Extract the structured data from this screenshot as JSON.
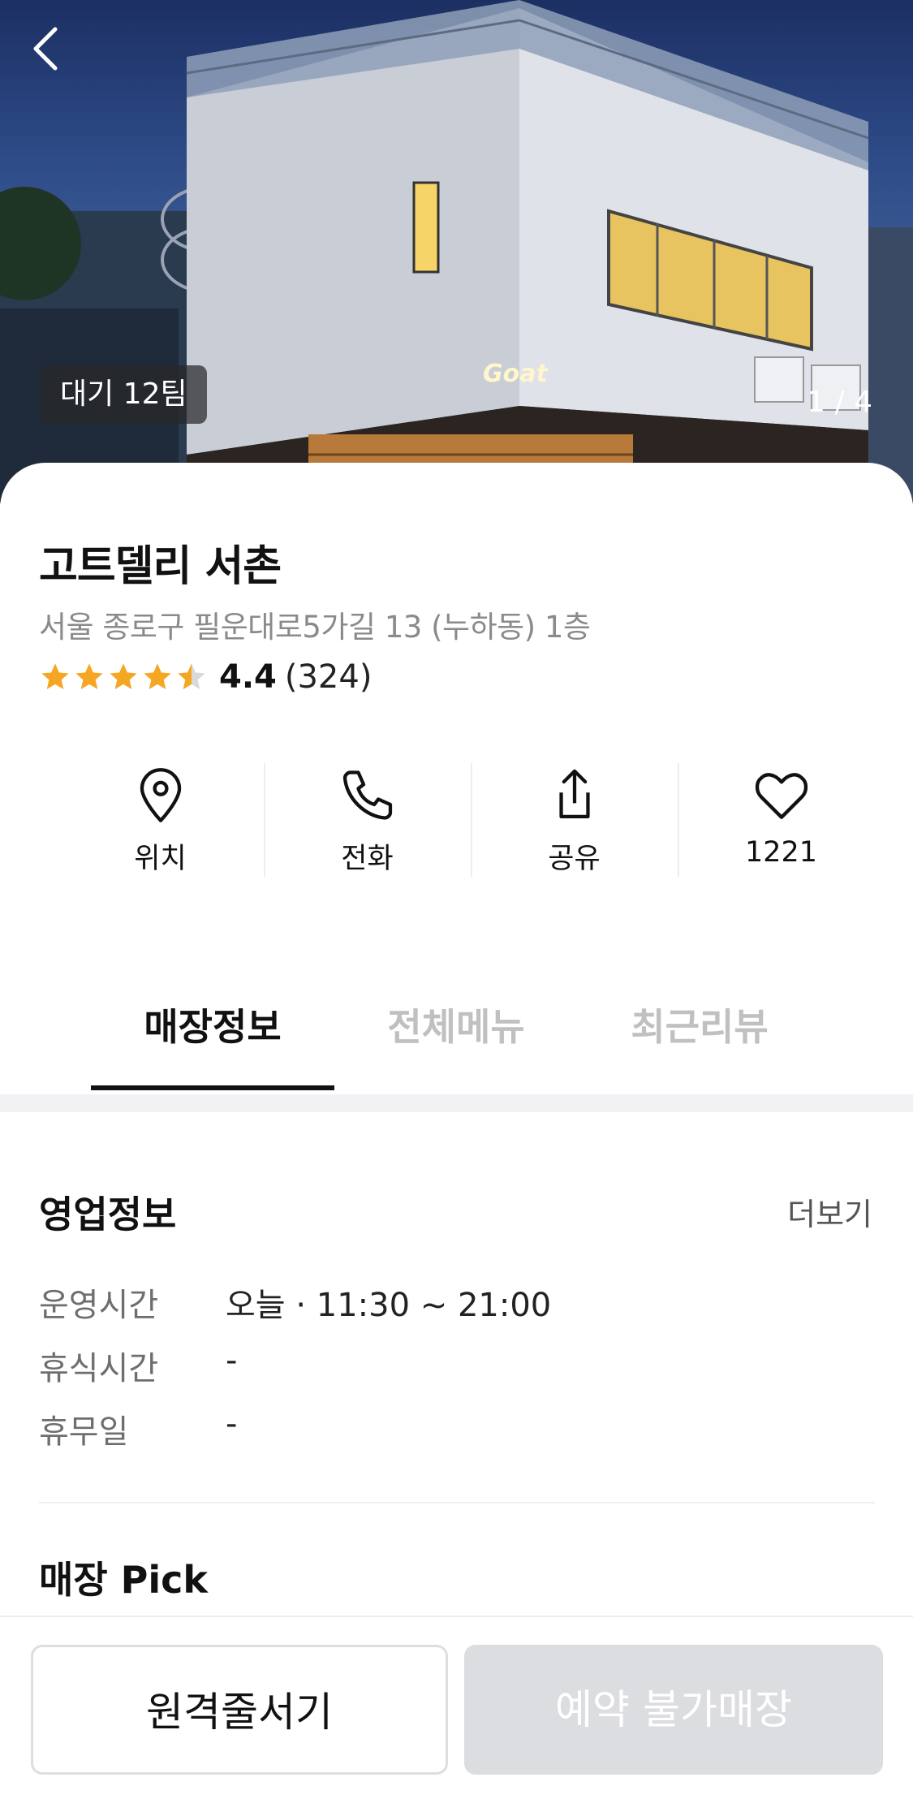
{
  "hero": {
    "wait_badge": "대기 12팀",
    "image_counter": "1 / 4",
    "sign_text": "Goat"
  },
  "store": {
    "name": "고트델리 서촌",
    "address": "서울 종로구 필운대로5가길 13 (누하동) 1층",
    "rating": {
      "value": "4.4",
      "count": "(324)",
      "stars": 4.5,
      "star_color": "#F5A623"
    }
  },
  "actions": [
    {
      "label": "위치",
      "icon": "location-pin-icon"
    },
    {
      "label": "전화",
      "icon": "phone-icon"
    },
    {
      "label": "공유",
      "icon": "share-icon"
    },
    {
      "label": "1221",
      "icon": "heart-icon"
    }
  ],
  "tabs": [
    {
      "label": "매장정보",
      "active": true
    },
    {
      "label": "전체메뉴",
      "active": false
    },
    {
      "label": "최근리뷰",
      "active": false
    }
  ],
  "business_info": {
    "title": "영업정보",
    "more_label": "더보기",
    "rows": [
      {
        "label": "운영시간",
        "value": "오늘 · 11:30 ~ 21:00"
      },
      {
        "label": "휴식시간",
        "value": "-"
      },
      {
        "label": "휴무일",
        "value": "-"
      }
    ]
  },
  "store_pick": {
    "title": "매장 Pick"
  },
  "bottom_bar": {
    "remote_queue_label": "원격줄서기",
    "reservation_label": "예약 불가매장"
  }
}
